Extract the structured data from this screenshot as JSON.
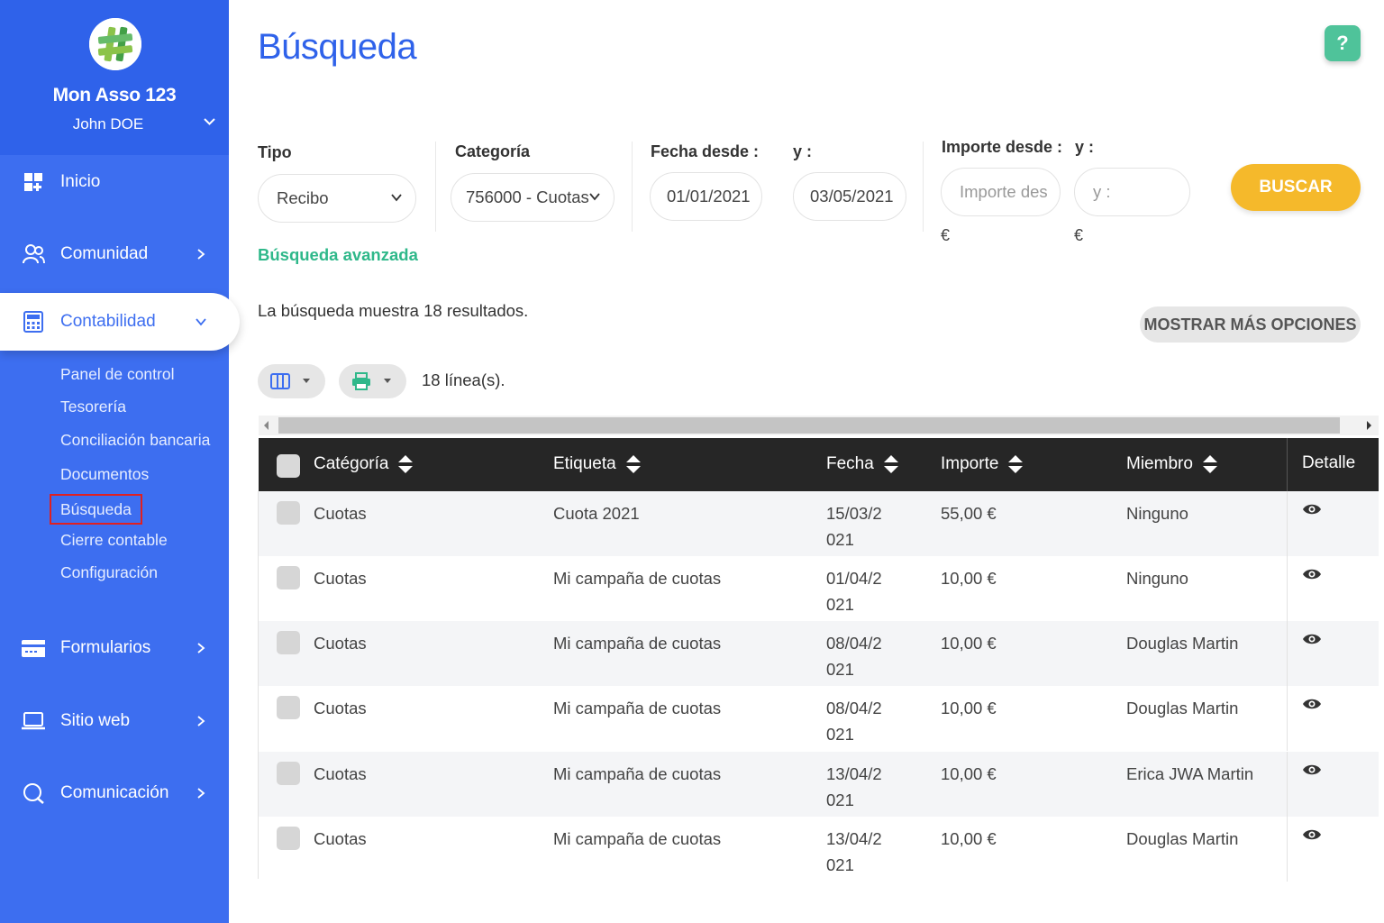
{
  "sidebar": {
    "org_name": "Mon Asso 123",
    "user_name": "John DOE",
    "nav": {
      "inicio": "Inicio",
      "comunidad": "Comunidad",
      "contabilidad": "Contabilidad",
      "formularios": "Formularios",
      "sitio_web": "Sitio web",
      "comunicacion": "Comunicación"
    },
    "sub_items": [
      "Panel de control",
      "Tesorería",
      "Conciliación bancaria",
      "Documentos",
      "Búsqueda",
      "Cierre contable",
      "Configuración"
    ]
  },
  "header": {
    "title": "Búsqueda",
    "help": "?"
  },
  "filters": {
    "tipo_label": "Tipo",
    "tipo_value": "Recibo",
    "categoria_label": "Categoría",
    "categoria_value": "756000 - Cuotas",
    "fecha_desde_label": "Fecha desde :",
    "fecha_desde_value": "01/01/2021",
    "fecha_hasta_label": "y :",
    "fecha_hasta_value": "03/05/2021",
    "importe_desde_label": "Importe desde :",
    "importe_desde_placeholder": "Importe des",
    "importe_hasta_label": "y :",
    "importe_hasta_placeholder": "y :",
    "currency": "€",
    "search_button": "BUSCAR",
    "advanced_link": "Búsqueda avanzada"
  },
  "results": {
    "summary": "La búsqueda muestra 18 resultados.",
    "more_options": "MOSTRAR MÁS OPCIONES",
    "lines": "18 línea(s)."
  },
  "table": {
    "headers": [
      "Catégoría",
      "Etiqueta",
      "Fecha",
      "Importe",
      "Miembro",
      "Detalle"
    ],
    "rows": [
      {
        "categoria": "Cuotas",
        "etiqueta": "Cuota 2021",
        "fecha_1": "15/03/2",
        "fecha_2": "021",
        "importe": "55,00 €",
        "miembro": "Ninguno"
      },
      {
        "categoria": "Cuotas",
        "etiqueta": "Mi campaña de cuotas",
        "fecha_1": "01/04/2",
        "fecha_2": "021",
        "importe": "10,00 €",
        "miembro": "Ninguno"
      },
      {
        "categoria": "Cuotas",
        "etiqueta": "Mi campaña de cuotas",
        "fecha_1": "08/04/2",
        "fecha_2": "021",
        "importe": "10,00 €",
        "miembro": "Douglas Martin"
      },
      {
        "categoria": "Cuotas",
        "etiqueta": "Mi campaña de cuotas",
        "fecha_1": "08/04/2",
        "fecha_2": "021",
        "importe": "10,00 €",
        "miembro": "Douglas Martin"
      },
      {
        "categoria": "Cuotas",
        "etiqueta": "Mi campaña de cuotas",
        "fecha_1": "13/04/2",
        "fecha_2": "021",
        "importe": "10,00 €",
        "miembro": "Erica JWA Martin"
      },
      {
        "categoria": "Cuotas",
        "etiqueta": "Mi campaña de cuotas",
        "fecha_1": "13/04/2",
        "fecha_2": "021",
        "importe": "10,00 €",
        "miembro": "Douglas Martin"
      }
    ]
  },
  "colors": {
    "sidebar": "#3d6ef0",
    "title": "#2f62ea",
    "accent_green": "#2fb88a",
    "button_yellow": "#f5b92b",
    "table_header": "#262626"
  }
}
